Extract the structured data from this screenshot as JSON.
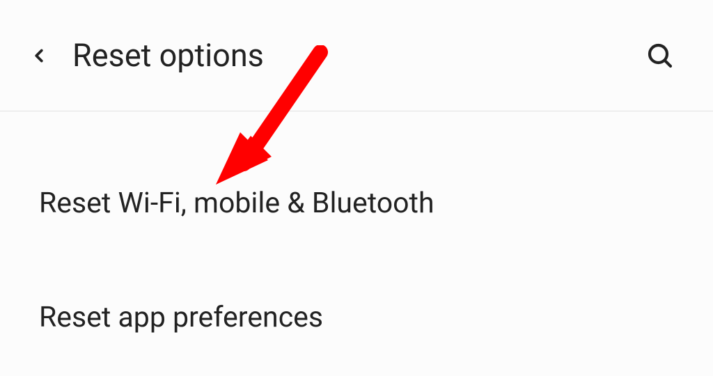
{
  "header": {
    "title": "Reset options"
  },
  "options": {
    "item0": "Reset Wi-Fi, mobile & Bluetooth",
    "item1": "Reset app preferences"
  },
  "annotation": {
    "color": "#ff0000"
  }
}
